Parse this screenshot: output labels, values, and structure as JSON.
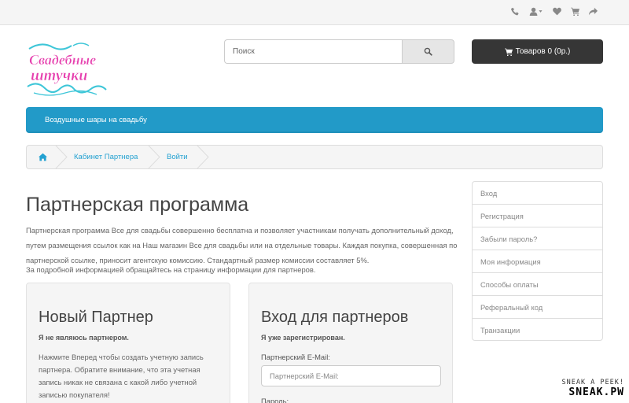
{
  "topbar": {
    "icons": [
      "phone-icon",
      "user-icon",
      "heart-icon",
      "cart-icon",
      "share-icon"
    ]
  },
  "logo": {
    "line1": "Свадебные",
    "line2": "штучки"
  },
  "search": {
    "placeholder": "Поиск"
  },
  "cart": {
    "label": "Товаров 0 (0р.)"
  },
  "menu": {
    "item": "Воздушные шары на свадьбу"
  },
  "breadcrumb": {
    "items": [
      "Кабинет Партнера",
      "Войти"
    ]
  },
  "page": {
    "title": "Партнерская программа",
    "intro": "Партнерская программа Все для свадьбы совершенно бесплатна и позволяет участникам получать дополнительный доход, путем размещения ссылок как на Наш магазин Все для свадьбы или на отдельные товары. Каждая покупка, совершенная по партнерской ссылке, приносит агентскую комиссию. Стандартный размер комиссии составляет 5%.",
    "info": "За подробной информацией обращайтесь на страницу информации для партнеров."
  },
  "new_partner": {
    "title": "Новый Партнер",
    "subtitle": "Я не являюсь партнером.",
    "text": "Нажмите Вперед чтобы создать учетную запись партнера. Обратите внимание, что эта учетная запись никак не связана с какой либо учетной записью покупателя!"
  },
  "login": {
    "title": "Вход для партнеров",
    "subtitle": "Я уже зарегистрирован.",
    "email_label": "Партнерский E-Mail:",
    "email_placeholder": "Партнерский E-Mail:",
    "password_label": "Пароль:"
  },
  "sidebar": {
    "items": [
      "Вход",
      "Регистрация",
      "Забыли пароль?",
      "Моя информация",
      "Способы оплаты",
      "Реферальный код",
      "Транзакции"
    ]
  },
  "watermark": {
    "line1": "SNEAK A PEEK!",
    "line2": "SNEAK.PW"
  },
  "colors": {
    "menu": "#229ac8",
    "link": "#23a1d1",
    "cart": "#363636"
  }
}
